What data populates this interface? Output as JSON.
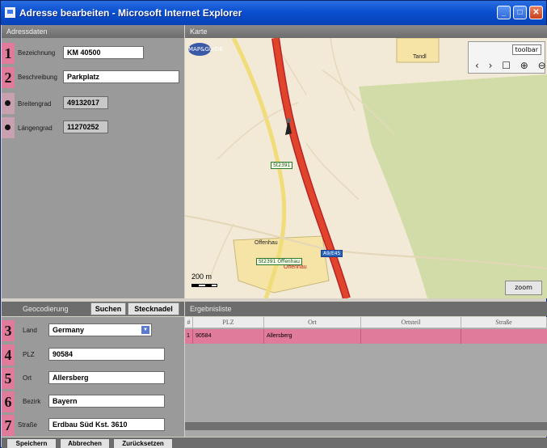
{
  "window": {
    "title": "Adresse bearbeiten - Microsoft Internet Explorer"
  },
  "address_panel": {
    "title": "Adressdaten",
    "fields": [
      {
        "marker": "1",
        "label": "Bezeichnung",
        "value": "KM 40500"
      },
      {
        "marker": "2",
        "label": "Beschreibung",
        "value": "Parkplatz"
      },
      {
        "marker": "",
        "label": "Breitengrad",
        "value": "49132017"
      },
      {
        "marker": "",
        "label": "Längengrad",
        "value": "11270252"
      }
    ]
  },
  "map": {
    "title": "Karte",
    "logo": "MAP&GUIDE",
    "toolbar_label": "toolbar",
    "tool_icons": [
      "arrow-left-right-icon",
      "hand-icon",
      "zoom-in-icon",
      "zoom-out-icon"
    ],
    "tools_text": "‹ › ☐ ⊕ ⊖",
    "zoom_label": "zoom",
    "scale_label": "200 m",
    "places": [
      "Tandl",
      "Offenhau",
      "Offenhau"
    ],
    "road_signs": [
      "St2391",
      "St2391 Offenhau",
      "A9/E45"
    ]
  },
  "geocoding": {
    "title": "Geocodierung",
    "tabs": [
      "Suchen",
      "Stecknadel"
    ],
    "fields": [
      {
        "marker": "3",
        "label": "Land",
        "value": "Germany"
      },
      {
        "marker": "4",
        "label": "PLZ",
        "value": "90584"
      },
      {
        "marker": "5",
        "label": "Ort",
        "value": "Allersberg"
      },
      {
        "marker": "6",
        "label": "Bezirk",
        "value": "Bayern"
      },
      {
        "marker": "7",
        "label": "Straße",
        "value": "Erdbau Süd Kst. 3610"
      }
    ]
  },
  "results": {
    "title": "Ergebnisliste",
    "columns": [
      "#",
      "PLZ",
      "Ort",
      "Ortsteil",
      "Straße"
    ],
    "rows": [
      [
        "1",
        "90584",
        "Allersberg",
        "",
        ""
      ]
    ]
  },
  "buttons": [
    "Speichern",
    "Abbrechen",
    "Zurücksetzen"
  ],
  "colors": {
    "title_bar": "#0a4fd0",
    "marker_pink": "#e07b9b",
    "panel_gray": "#9a9a9a",
    "highway": "#e0442a",
    "green_area": "#d2dca8"
  }
}
